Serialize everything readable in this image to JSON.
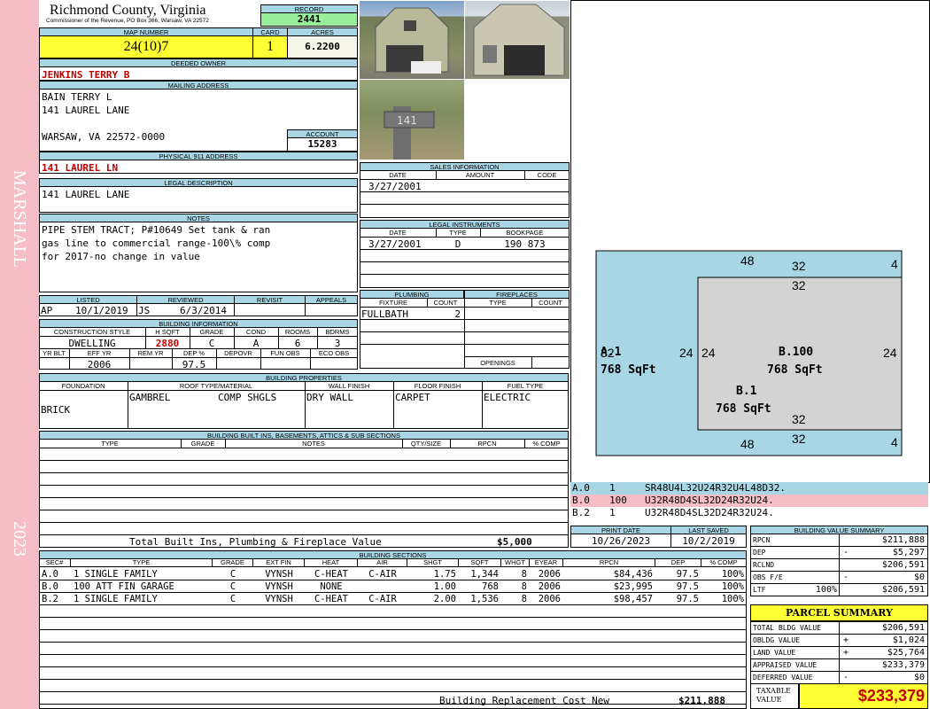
{
  "side": {
    "left_top": "MARSHALL",
    "left_bottom": "2023"
  },
  "county": {
    "name": "Richmond County, Virginia",
    "subtitle": "Commissioner of the Revenue, PO Box 366, Warsaw, VA 22572"
  },
  "record": {
    "label": "RECORD",
    "value": "2441"
  },
  "map": {
    "label": "MAP NUMBER",
    "value": "24(10)7"
  },
  "card": {
    "label": "CARD",
    "value": "1"
  },
  "acres": {
    "label": "ACRES",
    "value": "6.2200"
  },
  "owner": {
    "label": "DEEDED OWNER",
    "value": "JENKINS TERRY B"
  },
  "mailing": {
    "label": "MAILING ADDRESS",
    "line1": "BAIN TERRY L",
    "line2": "141 LAUREL LANE",
    "line3": "WARSAW, VA 22572-0000"
  },
  "account": {
    "label": "ACCOUNT",
    "value": "15283"
  },
  "physical": {
    "label": "PHYSICAL 911 ADDRESS",
    "value": "141 LAUREL LN"
  },
  "legal": {
    "label": "LEGAL DESCRIPTION",
    "value": "141 LAUREL LANE"
  },
  "notes": {
    "label": "NOTES",
    "line1": "PIPE STEM TRACT; P#10649 Set tank & ran",
    "line2": "gas line to commercial range-100\\% comp",
    "line3": "for 2017-no change in value"
  },
  "listed": {
    "label": "LISTED",
    "who": "AP",
    "date": "10/1/2019"
  },
  "reviewed": {
    "label": "REVIEWED",
    "who": "JS",
    "date": "6/3/2014"
  },
  "revisit": {
    "label": "REVISIT"
  },
  "appeals": {
    "label": "APPEALS"
  },
  "building_info": {
    "label": "BUILDING INFORMATION",
    "h_construction": "CONSTRUCTION STYLE",
    "h_hsqft": "H SQFT",
    "h_grade": "GRADE",
    "h_cond": "COND",
    "h_rooms": "ROOMS",
    "h_bdrms": "BDRMS",
    "construction": "DWELLING",
    "hsqft": "2880",
    "grade": "C",
    "cond": "A",
    "rooms": "6",
    "bdrms": "3",
    "h_yrblt": "YR BLT",
    "h_effyr": "EFF YR",
    "h_remyr": "REM YR",
    "h_dep": "DEP %",
    "h_depovr": "DEPOVR",
    "h_funobs": "FUN OBS",
    "h_ecoobs": "ECO OBS",
    "effyr": "2006",
    "dep": "97.5"
  },
  "sales": {
    "label": "SALES INFORMATION",
    "h_date": "DATE",
    "h_amount": "AMOUNT",
    "h_code": "CODE",
    "date": "3/27/2001"
  },
  "instruments": {
    "label": "LEGAL INSTRUMENTS",
    "h_date": "DATE",
    "h_type": "TYPE",
    "h_bookpage": "BOOKPAGE",
    "date": "3/27/2001",
    "type": "D",
    "bookpage": "190 873"
  },
  "plumbing": {
    "label": "PLUMBING",
    "h_fixture": "FIXTURE",
    "h_count": "COUNT",
    "fixture": "FULLBATH",
    "count": "2"
  },
  "fireplaces": {
    "label": "FIREPLACES",
    "h_type": "TYPE",
    "h_count": "COUNT",
    "openings": "OPENINGS"
  },
  "properties": {
    "label": "BUILDING PROPERTIES",
    "h_foundation": "FOUNDATION",
    "h_roof": "ROOF TYPE/MATERIAL",
    "h_wall": "WALL FINISH",
    "h_floor": "FLOOR FINISH",
    "h_fuel": "FUEL TYPE",
    "foundation": "BRICK",
    "roof_type": "GAMBREL",
    "roof_material": "COMP SHGLS",
    "wall": "DRY WALL",
    "floor": "CARPET",
    "fuel": "ELECTRIC"
  },
  "builtins": {
    "label": "BUILDING BUILT INS, BASEMENTS, ATTICS & SUB SECTIONS",
    "h_type": "TYPE",
    "h_grade": "GRADE",
    "h_notes": "NOTES",
    "h_qty": "QTY/SIZE",
    "h_rpcn": "RPCN",
    "h_comp": "% COMP",
    "total_label": "Total Built Ins, Plumbing & Fireplace Value",
    "total_value": "$5,000"
  },
  "print_date": {
    "label": "PRINT DATE",
    "value": "10/26/2023"
  },
  "last_saved": {
    "label": "LAST SAVED",
    "value": "10/2/2019"
  },
  "sketch": {
    "a_label": "A.1",
    "a_area": "768 SqFt",
    "b100_label": "B.100",
    "b100_area": "768 SqFt",
    "b1_label": "B.1",
    "b1_area": "768 SqFt",
    "dim_48_top": "48",
    "dim_4_top": "4",
    "dim_32_top": "32",
    "dim_32_inner_top": "32",
    "dim_32_left": "32",
    "dim_24_a": "24",
    "dim_24_b": "24",
    "dim_24_right": "24",
    "dim_32_inner_bottom": "32",
    "dim_48_bottom": "48",
    "dim_32_bottom": "32",
    "dim_4_bottom": "4"
  },
  "trace_rows": [
    {
      "sec": "A.0",
      "num": "1",
      "code": "SR48U4L32U24R32U4L48D32.",
      "color": "#a9d6e5"
    },
    {
      "sec": "B.0",
      "num": "100",
      "code": "U32R48D4SL32D24R32U24.",
      "color": "#f7bdc6"
    },
    {
      "sec": "B.2",
      "num": "1",
      "code": "U32R48D4SL32D24R32U24.",
      "color": "#ffffff"
    }
  ],
  "sections": {
    "label": "BUILDING SECTIONS",
    "headers": [
      "SEC#",
      "TYPE",
      "GRADE",
      "EXT FIN",
      "HEAT",
      "AIR",
      "SHGT",
      "SQFT",
      "WHGT",
      "EYEAR",
      "RPCN",
      "DEP",
      "% COMP"
    ],
    "rows": [
      {
        "sec": "A.0",
        "type": "1 SINGLE FAMILY",
        "grade": "C",
        "extfin": "VYNSH",
        "heat": "C-HEAT",
        "air": "C-AIR",
        "shgt": "1.75",
        "sqft": "1,344",
        "whgt": "8",
        "eyear": "2006",
        "rpcn": "$84,436",
        "dep": "97.5",
        "comp": "100%"
      },
      {
        "sec": "B.0",
        "type": "100 ATT FIN GARAGE",
        "grade": "C",
        "extfin": "VYNSH",
        "heat": "NONE",
        "air": "",
        "shgt": "1.00",
        "sqft": "768",
        "whgt": "8",
        "eyear": "2006",
        "rpcn": "$23,995",
        "dep": "97.5",
        "comp": "100%"
      },
      {
        "sec": "B.2",
        "type": "1 SINGLE FAMILY",
        "grade": "C",
        "extfin": "VYNSH",
        "heat": "C-HEAT",
        "air": "C-AIR",
        "shgt": "2.00",
        "sqft": "1,536",
        "whgt": "8",
        "eyear": "2006",
        "rpcn": "$98,457",
        "dep": "97.5",
        "comp": "100%"
      }
    ],
    "replacement_label": "Building Replacement Cost New",
    "replacement_value": "$211,888"
  },
  "value_summary": {
    "label": "BUILDING VALUE SUMMARY",
    "rows": [
      {
        "k": "RPCN",
        "sign": "",
        "pct": "",
        "v": "$211,888"
      },
      {
        "k": "DEP",
        "sign": "-",
        "pct": "",
        "v": "$5,297"
      },
      {
        "k": "RCLND",
        "sign": "",
        "pct": "",
        "v": "$206,591"
      },
      {
        "k": "OBS F/E",
        "sign": "-",
        "pct": "",
        "v": "$0"
      },
      {
        "k": "LTF",
        "sign": "",
        "pct": "100%",
        "v": "$206,591"
      }
    ]
  },
  "parcel": {
    "label": "PARCEL SUMMARY",
    "rows": [
      {
        "k": "TOTAL BLDG VALUE",
        "sign": "",
        "v": "$206,591"
      },
      {
        "k": "OBLDG VALUE",
        "sign": "+",
        "v": "$1,024"
      },
      {
        "k": "LAND VALUE",
        "sign": "+",
        "v": "$25,764"
      },
      {
        "k": "APPRAISED VALUE",
        "sign": "",
        "v": "$233,379"
      },
      {
        "k": "DEFERRED VALUE",
        "sign": "-",
        "v": "$0"
      }
    ],
    "taxable_label_1": "TAXABLE",
    "taxable_label_2": "VALUE",
    "taxable_value": "$233,379"
  },
  "colors": {
    "header_blue": "#a9d6e5",
    "pink": "#f7bdc6",
    "yellow": "#ffff33",
    "green": "#99ee99",
    "red": "#c00000"
  }
}
